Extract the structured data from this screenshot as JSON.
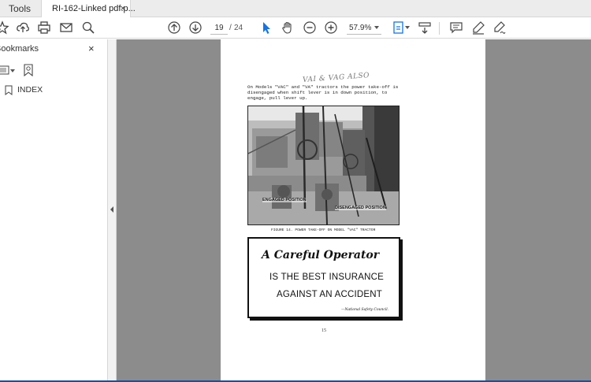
{
  "tabs": {
    "tools_label": "Tools",
    "document_label": "RI-162-Linked pdf.p...",
    "close_glyph": "×"
  },
  "toolbar": {
    "icons": [
      "bookmark-star-icon",
      "upload-icon",
      "print-icon",
      "email-icon",
      "search-zoom-icon",
      "page-up-icon",
      "page-down-icon",
      "select-arrow-icon",
      "hand-tool-icon",
      "zoom-out-icon",
      "zoom-in-icon",
      "fit-page-icon",
      "scroll-mode-icon",
      "comment-icon",
      "highlight-pen-icon",
      "sign-icon"
    ],
    "current_page": "19",
    "page_separator": "/",
    "total_pages": "24",
    "zoom": "57.9%",
    "accent_color": "#1473e6"
  },
  "sidebar": {
    "title": "Bookmarks",
    "close_glyph": "×",
    "items": [
      {
        "label": "INDEX"
      }
    ]
  },
  "document": {
    "handwritten_note": "VAI & VAG ALSO",
    "intro_text": "On Models \"VAC\" and \"VA\" tractors the power take-off is disengaged when shift lever is in down position, to engage, pull lever up.",
    "photo_label_engaged": "ENGAGED POSITION",
    "photo_label_disengaged": "DISENGAGED POSITION",
    "figure_caption": "FIGURE 14. POWER TAKE-OFF ON MODEL \"VAC\" TRACTOR",
    "banner_headline": "A Careful Operator",
    "banner_line1": "IS THE BEST INSURANCE",
    "banner_line2": "AGAINST AN ACCIDENT",
    "banner_credit": "—National Safety Council.",
    "page_number": "15"
  }
}
